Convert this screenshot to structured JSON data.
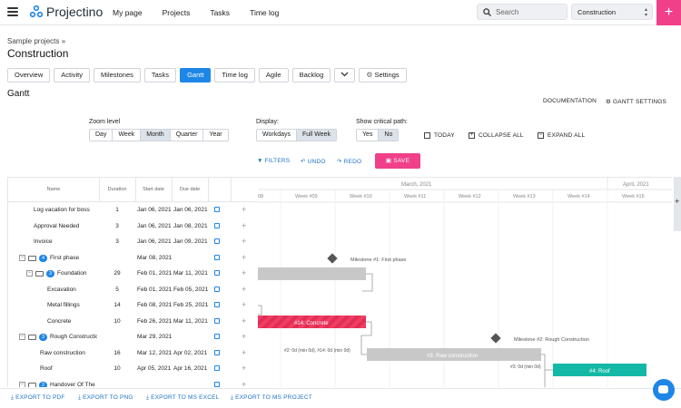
{
  "app": {
    "name": "Projectino"
  },
  "nav": {
    "items": [
      "My page",
      "Projects",
      "Tasks",
      "Time log"
    ]
  },
  "search": {
    "placeholder": "Search"
  },
  "project_select": {
    "value": "Construction"
  },
  "breadcrumb": "Sample projects »",
  "project_title": "Construction",
  "tabs": [
    "Overview",
    "Activity",
    "Milestones",
    "Tasks",
    "Gantt",
    "Time log",
    "Agile",
    "Backlog",
    "",
    "Settings"
  ],
  "active_tab": "Gantt",
  "page_heading": "Gantt",
  "header_links": {
    "documentation": "DOCUMENTATION",
    "settings": "GANTT SETTINGS"
  },
  "zoom": {
    "label": "Zoom level",
    "options": [
      "Day",
      "Week",
      "Month",
      "Quarter",
      "Year"
    ],
    "selected": "Month"
  },
  "display": {
    "label": "Display:",
    "options": [
      "Workdays",
      "Full Week"
    ],
    "selected": "Full Week"
  },
  "critical_path": {
    "label": "Show critical path:",
    "options": [
      "Yes",
      "No"
    ],
    "selected": "No"
  },
  "actions": {
    "today": "TODAY",
    "collapse": "COLLAPSE ALL",
    "expand": "EXPAND ALL"
  },
  "toolbar": {
    "filters": "FILTERS",
    "undo": "UNDO",
    "redo": "REDO",
    "save": "SAVE"
  },
  "grid": {
    "columns": [
      "Name",
      "Duration",
      "Start date",
      "Due date"
    ],
    "rows": [
      {
        "name": "Log vacation for boss",
        "duration": "1",
        "start": "Jan 06, 2021",
        "due": "Jan 06, 2021",
        "level": 0
      },
      {
        "name": "Approval Needed",
        "duration": "3",
        "start": "Jan 06, 2021",
        "due": "Jan 08, 2021",
        "level": 0
      },
      {
        "name": "Invoice",
        "duration": "3",
        "start": "Jan 06, 2021",
        "due": "Jan 09, 2021",
        "level": 0
      },
      {
        "name": "First phase",
        "duration": "",
        "start": "Mar 08, 2021",
        "due": "",
        "level": 0,
        "badge": "4",
        "group": true
      },
      {
        "name": "Foundation",
        "duration": "29",
        "start": "Feb 01, 2021",
        "due": "Mar 11, 2021",
        "level": 1,
        "badge": "3",
        "group": true
      },
      {
        "name": "Excavation",
        "duration": "5",
        "start": "Feb 01, 2021",
        "due": "Feb 05, 2021",
        "level": 2
      },
      {
        "name": "Metal fillings",
        "duration": "14",
        "start": "Feb 08, 2021",
        "due": "Feb 25, 2021",
        "level": 2
      },
      {
        "name": "Concrete",
        "duration": "10",
        "start": "Feb 26, 2021",
        "due": "Mar 11, 2021",
        "level": 2
      },
      {
        "name": "Rough Constructio",
        "duration": "",
        "start": "Mar 29, 2021",
        "due": "",
        "level": 0,
        "badge": "3",
        "group": true
      },
      {
        "name": "Raw construction",
        "duration": "16",
        "start": "Mar 12, 2021",
        "due": "Apr 02, 2021",
        "level": 1
      },
      {
        "name": "Roof",
        "duration": "10",
        "start": "Apr 05, 2021",
        "due": "Apr 16, 2021",
        "level": 1
      },
      {
        "name": "Handover Of The B",
        "duration": "",
        "start": "",
        "due": "",
        "level": 0,
        "badge": "2",
        "group": true
      }
    ]
  },
  "timeline": {
    "months": [
      "March, 2021",
      "April, 2021"
    ],
    "weeks": [
      "08",
      "Week #09",
      "Week #10",
      "Week #11",
      "Week #12",
      "Week #13",
      "Week #14",
      "Week #15"
    ],
    "milestones": [
      "Milestone #1: First phase",
      "Milestone #2: Rough Construction"
    ],
    "bars": [
      "#14: Concrete",
      "#3: Raw construction",
      "#4: Roof"
    ],
    "link_labels": [
      "#2: 0d (min 0d), #14: 0d (min 0d)",
      "#3: 0d (min 0d)"
    ]
  },
  "exports": [
    "EXPORT TO PDF",
    "EXPORT TO PNG",
    "EXPORT TO MS EXCEL",
    "EXPORT TO MS PROJECT"
  ],
  "colors": {
    "primary": "#1d86e6",
    "accent": "#f0408a",
    "roof_bar": "#14b8a6",
    "raw_bar": "#c8c8c8"
  }
}
